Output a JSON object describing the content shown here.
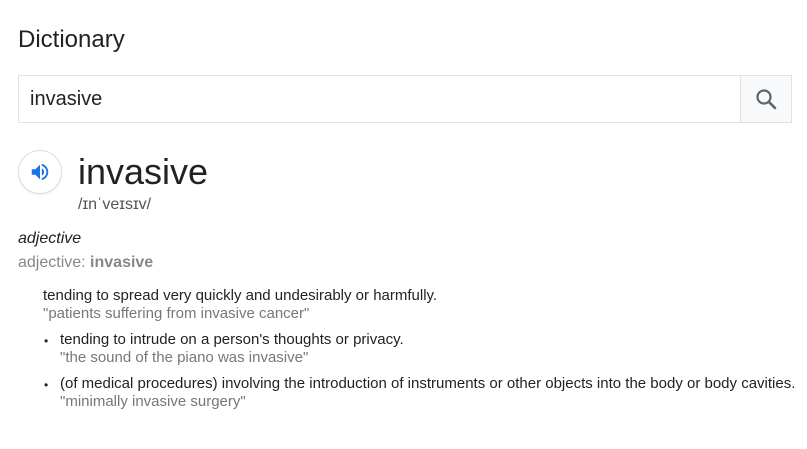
{
  "title": "Dictionary",
  "search": {
    "value": "invasive"
  },
  "entry": {
    "word": "invasive",
    "phonetic": "/ɪnˈveɪsɪv/",
    "part_of_speech": "adjective",
    "form_label": "adjective: ",
    "form_word": "invasive",
    "senses": [
      {
        "definition": "tending to spread very quickly and undesirably or harmfully.",
        "example": "\"patients suffering from invasive cancer\""
      },
      {
        "definition": "tending to intrude on a person's thoughts or privacy.",
        "example": "\"the sound of the piano was invasive\""
      },
      {
        "definition": "(of medical procedures) involving the introduction of instruments or other objects into the body or body cavities.",
        "example": "\"minimally invasive surgery\""
      }
    ]
  },
  "colors": {
    "audio_icon": "#1a73e8",
    "search_icon": "#5f6368",
    "muted_text": "#777777"
  }
}
